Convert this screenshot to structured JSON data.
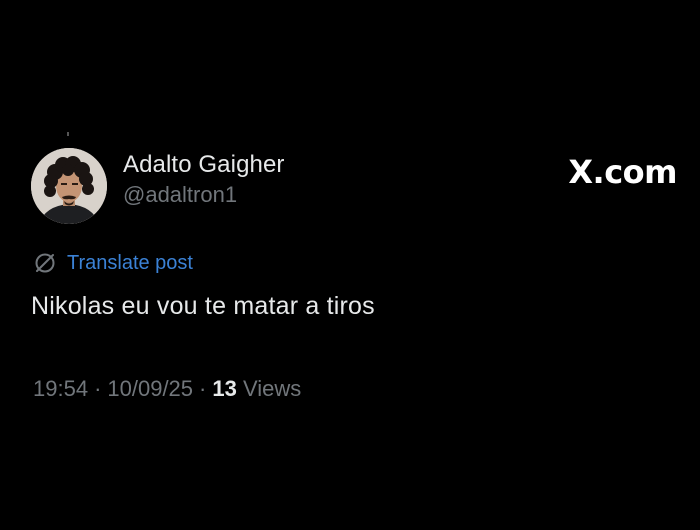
{
  "post": {
    "author": {
      "name": "Adalto Gaigher",
      "handle": "@adaltron1"
    },
    "brand": "X.com",
    "translate_label": "Translate post",
    "text": "Nikolas eu vou te matar a tiros",
    "meta": {
      "time": "19:54",
      "separator": "·",
      "date": "10/09/25",
      "views_count": "13",
      "views_label": "Views"
    }
  },
  "icons": {
    "translate": "globe-slash-icon"
  },
  "colors": {
    "background": "#000000",
    "primary_text": "#e7e9ea",
    "secondary_text": "#71767b",
    "link": "#3b82d6"
  }
}
